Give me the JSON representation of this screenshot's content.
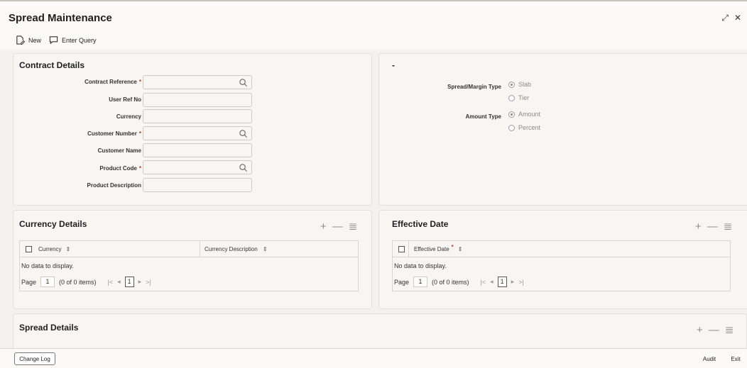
{
  "window": {
    "title": "Spread Maintenance",
    "resize_icon": "resize-icon",
    "close_icon": "close-icon"
  },
  "toolbar": {
    "new_label": "New",
    "enter_query_label": "Enter Query"
  },
  "contract_details": {
    "title": "Contract Details",
    "fields": {
      "contract_reference": "Contract Reference",
      "user_ref_no": "User Ref No",
      "currency": "Currency",
      "customer_number": "Customer Number",
      "customer_name": "Customer Name",
      "product_code": "Product Code",
      "product_description": "Product Description"
    },
    "required_mark": "*"
  },
  "right_panel": {
    "title": "-",
    "spread_margin_type_label": "Spread/Margin Type",
    "spread_options": [
      "Slab",
      "Tier"
    ],
    "spread_selected": "Slab",
    "amount_type_label": "Amount Type",
    "amount_options": [
      "Amount",
      "Percent"
    ],
    "amount_selected": "Amount"
  },
  "currency_details": {
    "title": "Currency Details",
    "columns": [
      "Currency",
      "Currency Description"
    ],
    "no_data": "No data to display.",
    "pager": {
      "page_label": "Page",
      "page_value": "1",
      "items_text": "(0 of 0 items)",
      "current_page": "1"
    }
  },
  "effective_date": {
    "title": "Effective Date",
    "columns": [
      "Effective Date"
    ],
    "required_mark": "*",
    "no_data": "No data to display.",
    "pager": {
      "page_label": "Page",
      "page_value": "1",
      "items_text": "(0 of 0 items)",
      "current_page": "1"
    }
  },
  "spread_details": {
    "title": "Spread Details"
  },
  "footer": {
    "change_log_label": "Change Log",
    "audit_label": "Audit",
    "exit_label": "Exit"
  },
  "grid_action_icons": {
    "add": "+",
    "remove": "—",
    "columns": "≣"
  }
}
